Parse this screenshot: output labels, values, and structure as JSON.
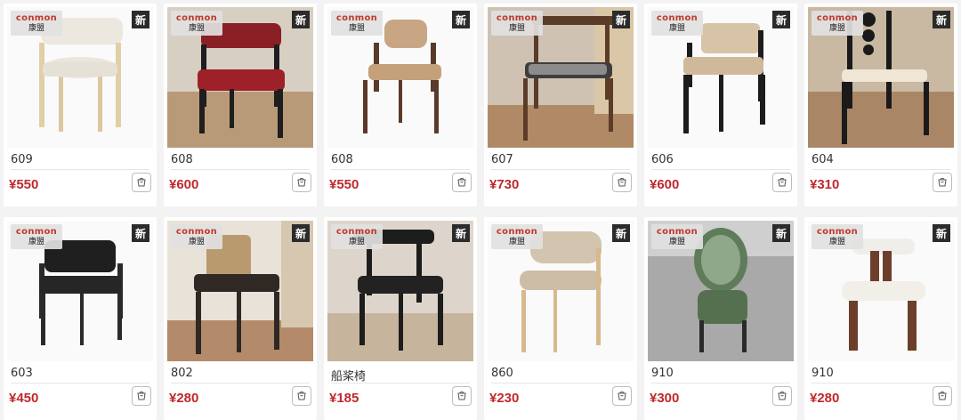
{
  "theme": {
    "price_color": "#c0282d",
    "badge_bg": "#2b2b2b",
    "brand_red": "#c0392b"
  },
  "brand": {
    "name": "conmon",
    "cn": "康盟"
  },
  "badge_label": "新",
  "products": [
    {
      "name": "609",
      "price": "¥550",
      "chair": "light-upholstered-round-seat",
      "background": "white"
    },
    {
      "name": "608",
      "price": "¥600",
      "chair": "black-frame-red-leather-armchair",
      "background": "room"
    },
    {
      "name": "608",
      "price": "¥550",
      "chair": "walnut-frame-tan-leather",
      "background": "white"
    },
    {
      "name": "607",
      "price": "¥730",
      "chair": "walnut-armchair-patterned-seat",
      "background": "room"
    },
    {
      "name": "606",
      "price": "¥600",
      "chair": "black-frame-beige-armchair",
      "background": "white"
    },
    {
      "name": "604",
      "price": "¥310",
      "chair": "black-ladder-back-armchair",
      "background": "room"
    },
    {
      "name": "603",
      "price": "¥450",
      "chair": "black-leather-armchair",
      "background": "white"
    },
    {
      "name": "802",
      "price": "¥280",
      "chair": "black-frame-rattan-back",
      "background": "room"
    },
    {
      "name": "船桨椅",
      "price": "¥185",
      "chair": "black-paddle-chair",
      "background": "room"
    },
    {
      "name": "860",
      "price": "¥230",
      "chair": "natural-wood-beige-shell",
      "background": "white"
    },
    {
      "name": "910",
      "price": "¥300",
      "chair": "green-patterned-round-back",
      "background": "gray"
    },
    {
      "name": "910",
      "price": "¥280",
      "chair": "walnut-white-boucle",
      "background": "white"
    }
  ]
}
